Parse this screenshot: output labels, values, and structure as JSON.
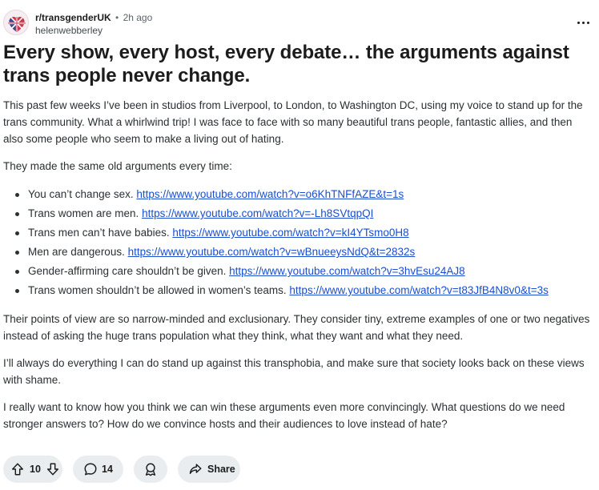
{
  "post": {
    "subreddit": "r/transgenderUK",
    "separator": "•",
    "time": "2h ago",
    "author": "helenwebberley",
    "title": "Every show, every host, every debate… the arguments against trans people never change.",
    "paragraphs": {
      "intro": "This past few weeks I’ve been in studios from Liverpool, to London, to Washington DC, using my voice to stand up for the trans community. What a whirlwind trip! I was face to face with so many beautiful trans people, fantastic allies, and then also some people who seem to make a living out of hating.",
      "lead": "They made the same old arguments every time:",
      "narrow": "Their points of view are so narrow-minded and exclusionary. They consider tiny, extreme examples of one or two negatives instead of asking the huge trans population what they think, what they want and what they need.",
      "always": "I’ll always do everything I can do stand up against this transphobia, and make sure that society looks back on these views with shame.",
      "question": "I really want to know how you think we can win these arguments even more convincingly. What questions do we need stronger answers to? How do we convince hosts and their audiences to love instead of hate?"
    },
    "arguments": [
      {
        "text": "You can’t change sex. ",
        "link": "https://www.youtube.com/watch?v=o6KhTNFfAZE&t=1s"
      },
      {
        "text": "Trans women are men. ",
        "link": "https://www.youtube.com/watch?v=-Lh8SVtqpQI"
      },
      {
        "text": "Trans men can’t have babies. ",
        "link": "https://www.youtube.com/watch?v=kI4YTsmo0H8"
      },
      {
        "text": "Men are dangerous. ",
        "link": "https://www.youtube.com/watch?v=wBnueeysNdQ&t=2832s"
      },
      {
        "text": "Gender-affirming care shouldn’t be given. ",
        "link": "https://www.youtube.com/watch?v=3hvEsu24AJ8"
      },
      {
        "text": "Trans women shouldn’t be allowed in women’s teams. ",
        "link": "https://www.youtube.com/watch?v=t83JfB4N8v0&t=3s"
      }
    ]
  },
  "actions": {
    "votes": "10",
    "comments": "14",
    "share_label": "Share"
  },
  "icons": {
    "more": "more-options-icon",
    "upvote": "upvote-arrow-icon",
    "downvote": "downvote-arrow-icon",
    "comment": "comment-bubble-icon",
    "award": "award-icon",
    "share": "share-arrow-icon"
  },
  "colors": {
    "link": "#1a4ecf",
    "pill_bg": "#eaedef",
    "text": "#1c1c1c"
  }
}
